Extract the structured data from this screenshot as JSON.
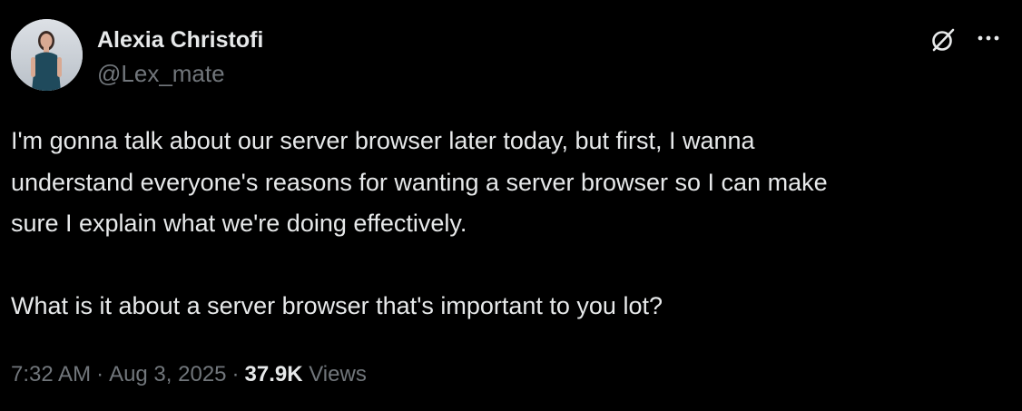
{
  "author": {
    "display_name": "Alexia Christofi",
    "handle": "@Lex_mate",
    "avatar_icon": "user-avatar"
  },
  "header_actions": {
    "grok_icon": "grok-slash-circle-icon",
    "more_icon": "more-horizontal-icon"
  },
  "tweet": {
    "paragraphs": [
      "I'm gonna talk about our server browser later today, but first, I wanna\nunderstand everyone's reasons for wanting a server browser so I can make\nsure I explain what we're doing effectively.",
      "What is it about a server browser that's important to you lot?"
    ]
  },
  "meta": {
    "time": "7:32 AM",
    "separator": "·",
    "date": "Aug 3, 2025",
    "views_count": "37.9K",
    "views_label": "Views"
  },
  "colors": {
    "background": "#000000",
    "primary_text": "#e7e9ea",
    "secondary_text": "#71767b"
  }
}
